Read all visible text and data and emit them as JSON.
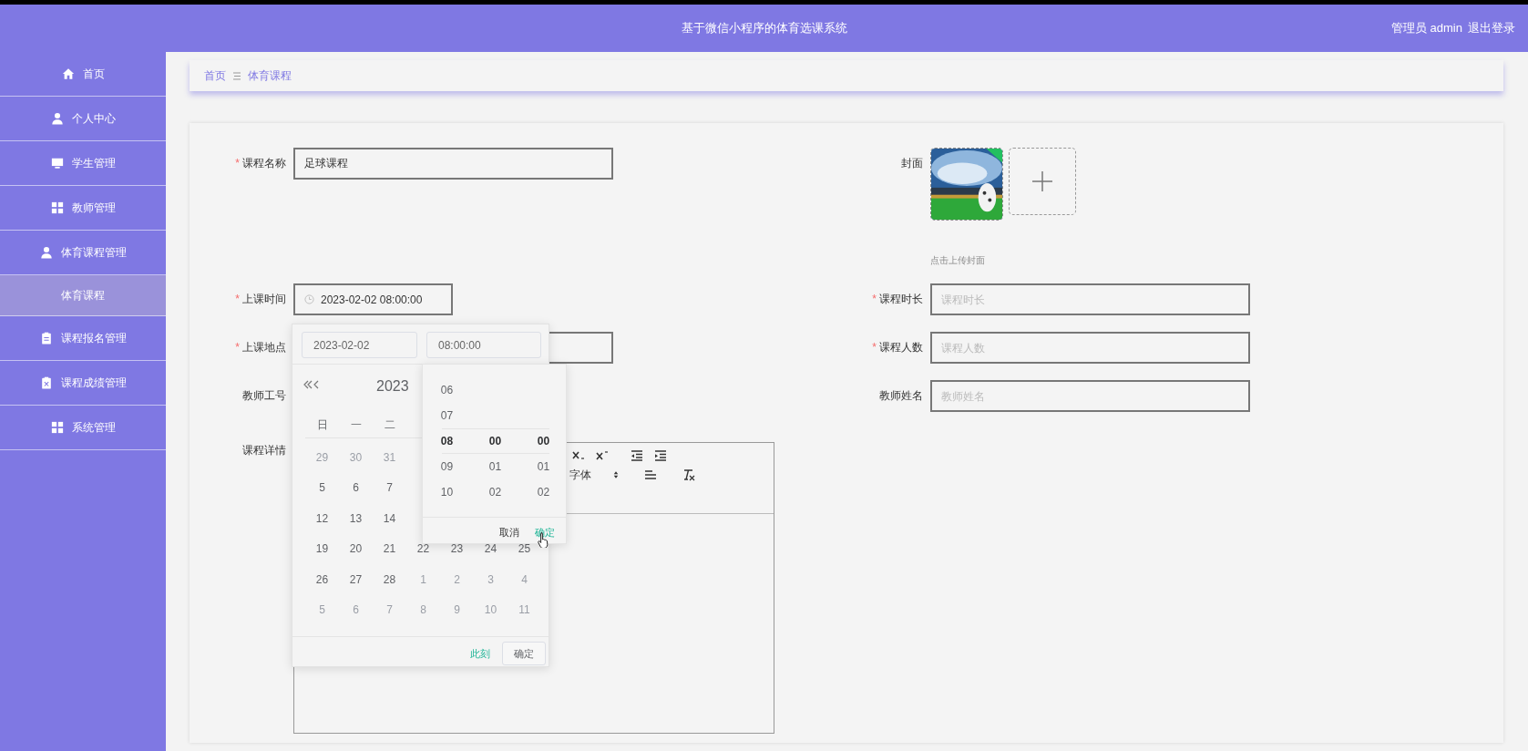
{
  "header": {
    "title": "基于微信小程序的体育选课系统",
    "user": "管理员 admin",
    "logout": "退出登录"
  },
  "sidebar": {
    "items": [
      {
        "label": "首页",
        "kind": "menu",
        "selected": false
      },
      {
        "label": "个人中心",
        "kind": "menu",
        "selected": false
      },
      {
        "label": "学生管理",
        "kind": "menu",
        "selected": false
      },
      {
        "label": "教师管理",
        "kind": "menu",
        "selected": false
      },
      {
        "label": "体育课程管理",
        "kind": "menu",
        "selected": false
      },
      {
        "label": "体育课程",
        "kind": "submenu",
        "selected": true
      },
      {
        "label": "课程报名管理",
        "kind": "menu",
        "selected": false
      },
      {
        "label": "课程成绩管理",
        "kind": "menu",
        "selected": false
      },
      {
        "label": "系统管理",
        "kind": "menu",
        "selected": false
      }
    ]
  },
  "breadcrumb": [
    {
      "label": "首页"
    },
    {
      "label": "体育课程"
    }
  ],
  "form": {
    "required_mark": "*",
    "left": [
      {
        "label": "课程名称",
        "required": true,
        "kind": "input",
        "value": "足球课程"
      },
      {
        "label": "上课时间",
        "required": true,
        "kind": "datetime",
        "value": "2023-02-02 08:00:00"
      },
      {
        "label": "上课地点",
        "required": true,
        "kind": "input"
      },
      {
        "label": "教师工号",
        "required": false,
        "kind": "covered"
      },
      {
        "label": "课程详情",
        "required": false,
        "kind": "editor",
        "font_select": "字体"
      }
    ],
    "right": [
      {
        "label": "封面",
        "required": false,
        "kind": "upload",
        "hint": "点击上传封面"
      },
      {
        "label": "课程时长",
        "required": true,
        "kind": "input",
        "placeholder": "课程时长"
      },
      {
        "label": "课程人数",
        "required": true,
        "kind": "input",
        "placeholder": "课程人数"
      },
      {
        "label": "教师姓名",
        "required": false,
        "kind": "input",
        "placeholder": "教师姓名"
      }
    ]
  },
  "date_picker": {
    "date_input": "2023-02-02",
    "time_input": "08:00:00",
    "header": "2023",
    "weekdays": [
      "日",
      "一",
      "二"
    ],
    "weeks": [
      [
        {
          "day": "29",
          "muted": true
        },
        {
          "day": "30",
          "muted": true
        },
        {
          "day": "31",
          "muted": true
        }
      ],
      [
        {
          "day": "5",
          "muted": false
        },
        {
          "day": "6",
          "muted": false
        },
        {
          "day": "7",
          "muted": false
        }
      ],
      [
        {
          "day": "12",
          "muted": false
        },
        {
          "day": "13",
          "muted": false
        },
        {
          "day": "14",
          "muted": false
        }
      ],
      [
        {
          "day": "19",
          "muted": false
        },
        {
          "day": "20",
          "muted": false
        },
        {
          "day": "21",
          "muted": false
        },
        {
          "day": "22",
          "muted": false
        },
        {
          "day": "23",
          "muted": false
        },
        {
          "day": "24",
          "muted": false
        },
        {
          "day": "25",
          "muted": false
        }
      ],
      [
        {
          "day": "26",
          "muted": false
        },
        {
          "day": "27",
          "muted": false
        },
        {
          "day": "28",
          "muted": false
        },
        {
          "day": "1",
          "muted": true
        },
        {
          "day": "2",
          "muted": true
        },
        {
          "day": "3",
          "muted": true
        },
        {
          "day": "4",
          "muted": true
        }
      ],
      [
        {
          "day": "5",
          "muted": true
        },
        {
          "day": "6",
          "muted": true
        },
        {
          "day": "7",
          "muted": true
        },
        {
          "day": "8",
          "muted": true
        },
        {
          "day": "9",
          "muted": true
        },
        {
          "day": "10",
          "muted": true
        },
        {
          "day": "11",
          "muted": true
        }
      ]
    ],
    "now_link": "此刻",
    "confirm": "确定"
  },
  "time_panel": {
    "columns": [
      {
        "items": [
          {
            "text": "06",
            "selected": false
          },
          {
            "text": "07",
            "selected": false
          },
          {
            "text": "08",
            "selected": true
          },
          {
            "text": "09",
            "selected": false
          },
          {
            "text": "10",
            "selected": false
          }
        ]
      },
      {
        "items": [
          {
            "text": "00",
            "selected": true
          },
          {
            "text": "01",
            "selected": false
          },
          {
            "text": "02",
            "selected": false
          }
        ]
      },
      {
        "items": [
          {
            "text": "00",
            "selected": true
          },
          {
            "text": "01",
            "selected": false
          },
          {
            "text": "02",
            "selected": false
          }
        ]
      }
    ],
    "cancel": "取消",
    "confirm": "确定"
  }
}
